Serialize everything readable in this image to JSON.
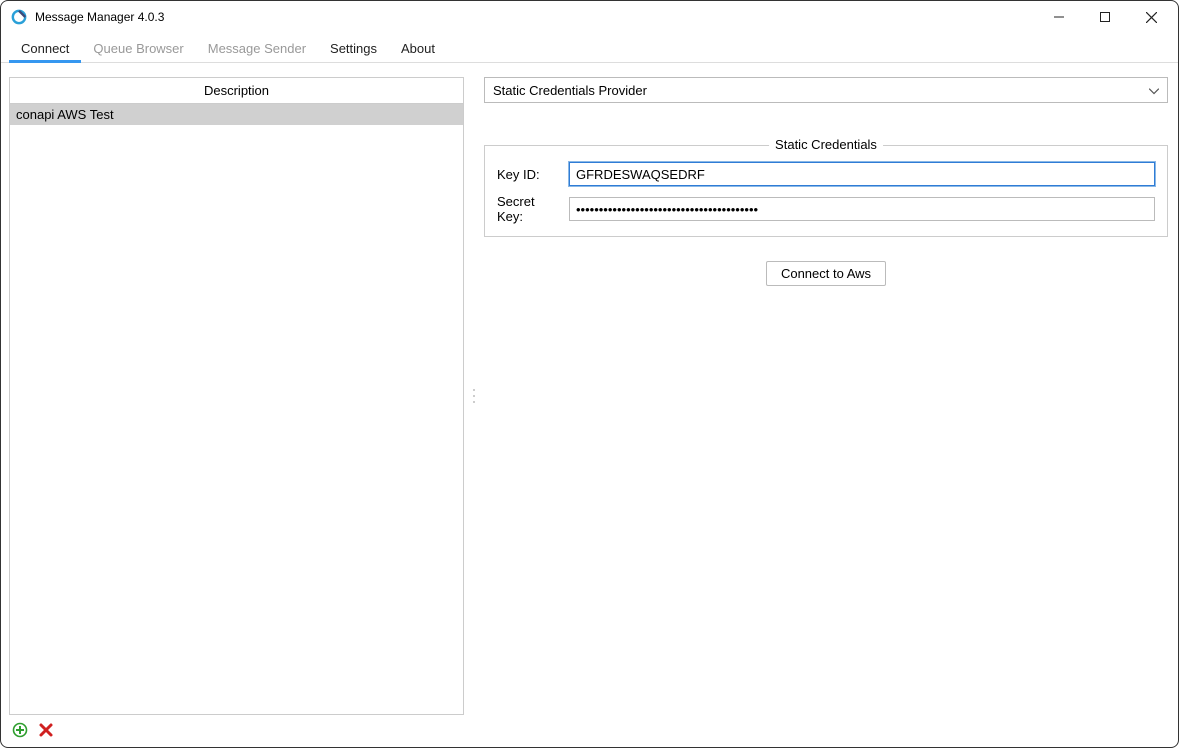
{
  "window": {
    "title": "Message Manager 4.0.3"
  },
  "tabs": [
    {
      "label": "Connect",
      "active": true,
      "enabled": true
    },
    {
      "label": "Queue Browser",
      "active": false,
      "enabled": false
    },
    {
      "label": "Message Sender",
      "active": false,
      "enabled": false
    },
    {
      "label": "Settings",
      "active": false,
      "enabled": true
    },
    {
      "label": "About",
      "active": false,
      "enabled": true
    }
  ],
  "left": {
    "header": "Description",
    "items": [
      {
        "label": "conapi AWS Test",
        "selected": true
      }
    ]
  },
  "right": {
    "provider_combo": "Static Credentials Provider",
    "credentials": {
      "legend": "Static Credentials",
      "key_id_label": "Key ID:",
      "key_id_value": "GFRDESWAQSEDRF",
      "secret_key_label": "Secret Key:",
      "secret_key_value": "••••••••••••••••••••••••••••••••••••••••"
    },
    "connect_button": "Connect to Aws"
  },
  "icons": {
    "add": "add-icon",
    "delete": "delete-icon"
  }
}
